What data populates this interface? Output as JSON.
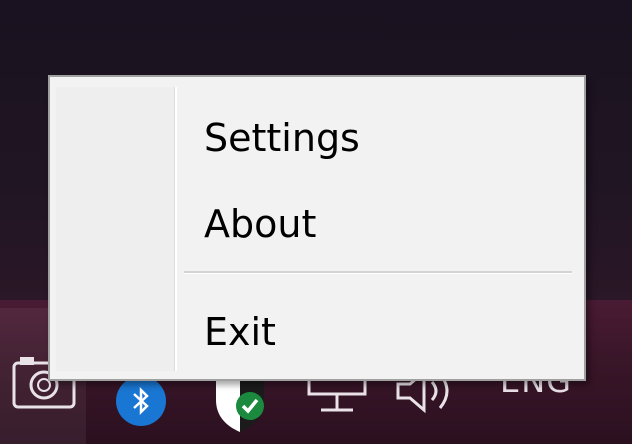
{
  "context_menu": {
    "items": [
      {
        "label": "Settings"
      },
      {
        "label": "About"
      },
      {
        "label": "Exit"
      }
    ]
  },
  "taskbar": {
    "language_indicator": "ENG",
    "icons": [
      "camera-icon",
      "bluetooth-icon",
      "shield-check-icon",
      "network-icon",
      "volume-icon"
    ]
  },
  "colors": {
    "menu_background": "#f2f2f2",
    "menu_border": "#a0a0a0",
    "taskbar": "#3a1629",
    "bluetooth": "#1976d2",
    "shield_check": "#1b8a3e"
  }
}
